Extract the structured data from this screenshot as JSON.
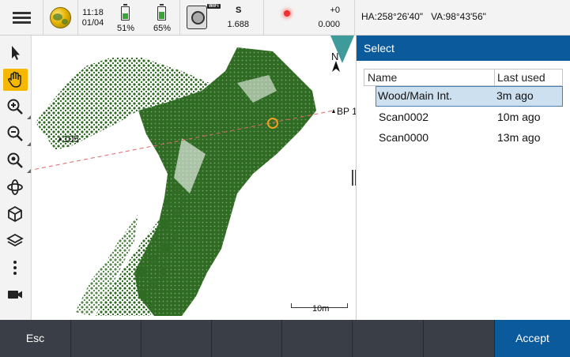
{
  "status": {
    "time": "11:18",
    "date": "01/04",
    "battery1_percent": "51%",
    "battery1_level": 0.51,
    "battery2_percent": "65%",
    "battery2_level": 0.65,
    "wifi_label": "WiFi",
    "instrument_mode": "S",
    "instrument_value": "1.688",
    "target_offset": "+0",
    "target_height": "0.000",
    "hava": "HA:258°26'40\"   VA:98°43'56\""
  },
  "toolbar": {
    "tools": [
      "select-arrow-icon",
      "pan-hand-icon",
      "zoom-in-icon",
      "zoom-out-icon",
      "zoom-extents-icon",
      "orbit-icon",
      "cube-view-icon",
      "layers-icon",
      "more-vertical-icon",
      "video-camera-icon"
    ],
    "active_tool": "pan-hand-icon"
  },
  "map": {
    "point_label_105": "105",
    "point_label_bp": "BP 1",
    "north_label": "N",
    "scale_label": "10m",
    "colors": {
      "scan": "#2f6b23",
      "scan_dark": "#1f5418",
      "line": "#e06666",
      "target": "#f0a020"
    }
  },
  "panel": {
    "title": "Select",
    "columns": [
      "Name",
      "Last used"
    ],
    "rows": [
      {
        "name": "Wood/Main Int.",
        "last_used": "3m ago",
        "selected": true
      },
      {
        "name": "Scan0002",
        "last_used": "10m ago",
        "selected": false
      },
      {
        "name": "Scan0000",
        "last_used": "13m ago",
        "selected": false
      }
    ]
  },
  "bottom": {
    "esc_label": "Esc",
    "accept_label": "Accept"
  },
  "colors": {
    "accent_blue": "#0b5a9c",
    "bottom_bar": "#3a3e47",
    "active_tool": "#f5b700",
    "selection": "#cde0f0"
  }
}
